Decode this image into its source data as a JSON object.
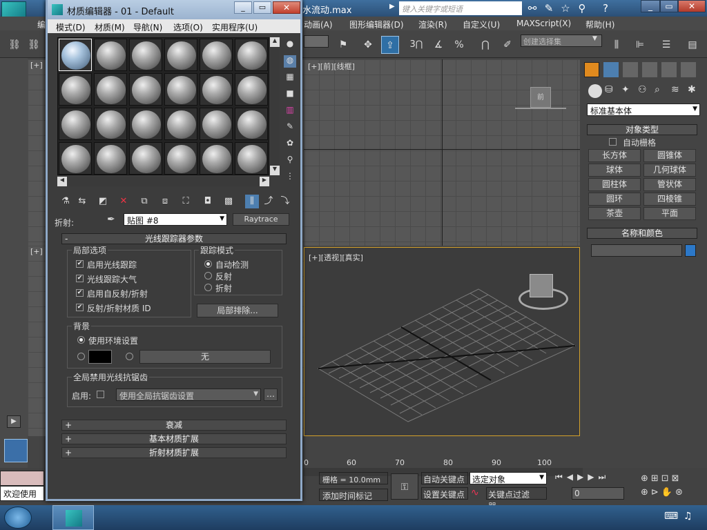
{
  "app": {
    "file_title": "水流动.max",
    "search_placeholder": "键入关键字或短语",
    "menu": [
      "动画(A)",
      "图形编辑器(D)",
      "渲染(R)",
      "自定义(U)",
      "MAXScript(X)",
      "帮助(H)"
    ],
    "menu_left_partial": "编"
  },
  "toolbar": {
    "selection_set_placeholder": "创建选择集",
    "snap_3": "3",
    "percent_snap": "%"
  },
  "viewports": {
    "top_left": "[+]",
    "front": "[+][前][线框]",
    "left_bottom": "[+]",
    "perspective": "[+][透视][真实]",
    "viewcube_front": "前"
  },
  "cmdpanel": {
    "category": "标准基本体",
    "object_type_title": "对象类型",
    "autogrid": "自动栅格",
    "objects": [
      "长方体",
      "圆锥体",
      "球体",
      "几何球体",
      "圆柱体",
      "管状体",
      "圆环",
      "四棱锥",
      "茶壶",
      "平面"
    ],
    "name_color_title": "名称和颜色",
    "swatch_color": "#2c78c8"
  },
  "status": {
    "welcome": "欢迎使用",
    "grid": "栅格 = 10.0mm",
    "add_time_tag": "添加时间标记",
    "auto_key": "自动关键点",
    "set_key": "设置关键点",
    "selected": "选定对象",
    "key_filters": "关键点过滤器...",
    "frame": "0",
    "ruler": [
      "60",
      "70",
      "80",
      "90",
      "100"
    ],
    "ruler_partial": "0"
  },
  "matedit": {
    "title": "材质编辑器 - 01 - Default",
    "menu": [
      "模式(D)",
      "材质(M)",
      "导航(N)",
      "选项(O)",
      "实用程序(U)"
    ],
    "refraction_label": "折射:",
    "map_name": "贴图 #8",
    "map_type": "Raytrace",
    "rollout_title": "光线跟踪器参数",
    "local_options": "局部选项",
    "options": [
      "启用光线跟踪",
      "光线跟踪大气",
      "启用自反射/折射",
      "反射/折射材质 ID"
    ],
    "trace_mode": "跟踪模式",
    "modes": [
      "自动检测",
      "反射",
      "折射"
    ],
    "local_exclude": "局部排除...",
    "background": "背景",
    "use_env": "使用环境设置",
    "none": "无",
    "global_aa": "全局禁用光线抗锯齿",
    "enable": "启用:",
    "use_global_aa": "使用全局抗锯齿设置",
    "rollups": [
      "衰减",
      "基本材质扩展",
      "折射材质扩展"
    ],
    "collapse_minus": "-",
    "collapse_plus": "+"
  }
}
